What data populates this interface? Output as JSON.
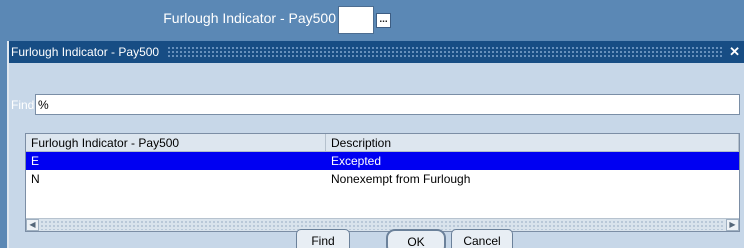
{
  "background_form": {
    "field_label": "Furlough Indicator - Pay500",
    "lov_button_label": "..."
  },
  "dialog": {
    "title": "Furlough Indicator - Pay500",
    "close_label": "✕",
    "find_label": "Find",
    "find_value": "%",
    "columns": [
      "Furlough Indicator - Pay500",
      "Description"
    ],
    "rows": [
      {
        "code": "E",
        "description": "Excepted",
        "selected": true
      },
      {
        "code": "N",
        "description": "Nonexempt from Furlough",
        "selected": false
      }
    ],
    "buttons": {
      "find": "Find",
      "ok": "OK",
      "cancel": "Cancel"
    }
  },
  "colors": {
    "desktop_bg": "#5b88b5",
    "titlebar": "#174d84",
    "selection": "#0000f2",
    "dialog_bg": "#c7d7e8"
  }
}
